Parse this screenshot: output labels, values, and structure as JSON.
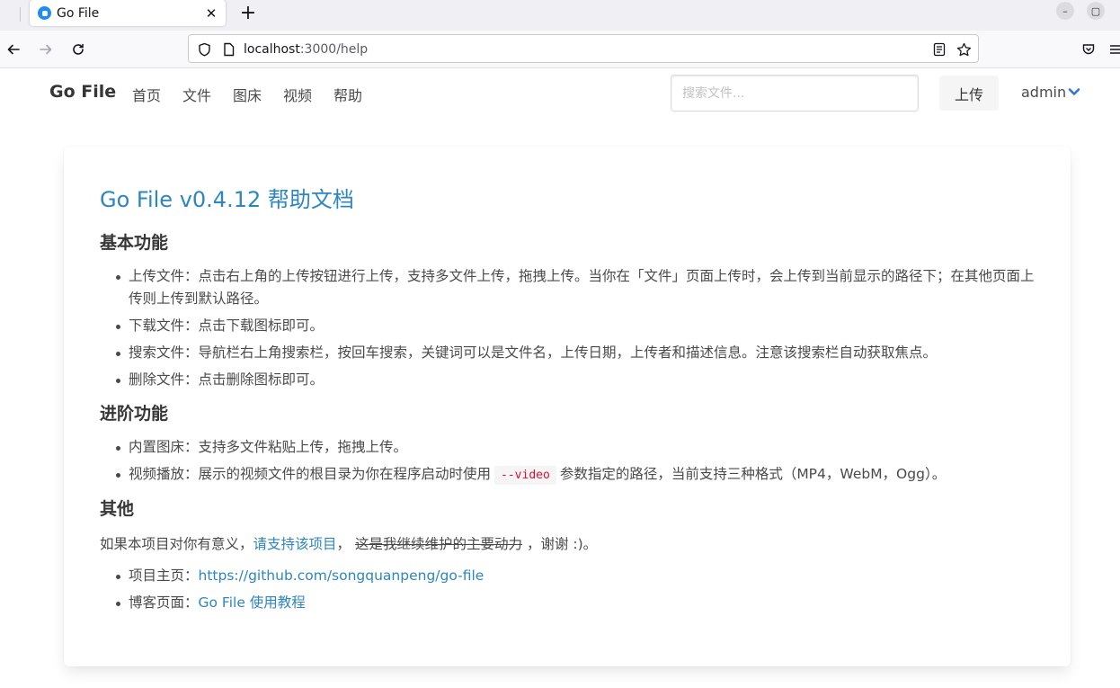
{
  "browser": {
    "tab_title": "Go File",
    "tab_close_glyph": "✕",
    "new_tab_glyph": "+",
    "url_host": "localhost",
    "url_rest": ":3000/help",
    "window_controls": [
      "–",
      "▢"
    ]
  },
  "header": {
    "brand": "Go File",
    "menu": [
      "首页",
      "文件",
      "图床",
      "视频",
      "帮助"
    ],
    "search_placeholder": "搜索文件...",
    "upload_label": "上传",
    "user_label": "admin"
  },
  "doc": {
    "title": "Go File v0.4.12 帮助文档",
    "sections": [
      {
        "heading": "基本功能",
        "items": [
          "上传文件：点击右上角的上传按钮进行上传，支持多文件上传，拖拽上传。当你在「文件」页面上传时，会上传到当前显示的路径下；在其他页面上传则上传到默认路径。",
          "下载文件：点击下载图标即可。",
          "搜索文件：导航栏右上角搜索栏，按回车搜索，关键词可以是文件名，上传日期，上传者和描述信息。注意该搜索栏自动获取焦点。",
          "删除文件：点击删除图标即可。"
        ]
      },
      {
        "heading": "进阶功能",
        "items": [
          "内置图床：支持多文件粘贴上传，拖拽上传。"
        ],
        "video_item": {
          "before": "视频播放：展示的视频文件的根目录为你在程序启动时使用",
          "code": "--video",
          "after": "参数指定的路径，当前支持三种格式（MP4，WebM，Ogg）。"
        }
      },
      {
        "heading": "其他",
        "para": {
          "before": "如果本项目对你有意义，",
          "link": "请支持该项目",
          "middle": "，",
          "strike": "这是我继续维护的主要动力",
          "after": "，谢谢 :)。"
        },
        "links": [
          {
            "label": "项目主页：",
            "text": "https://github.com/songquanpeng/go-file"
          },
          {
            "label": "博客页面：",
            "text": "Go File 使用教程"
          }
        ]
      }
    ]
  }
}
